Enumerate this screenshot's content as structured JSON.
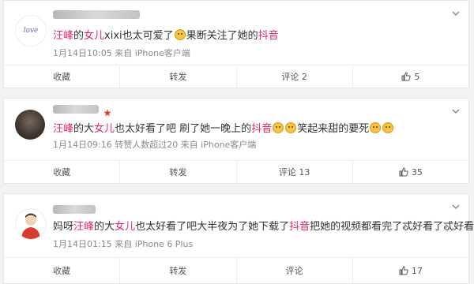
{
  "comments": [
    {
      "avatar_text": "love",
      "text_before": "",
      "highlight1": "汪峰",
      "text_mid1": "的",
      "highlight2": "女儿",
      "text_mid2": "xixi也太可爱了",
      "text_mid3": "果断关注了她的",
      "highlight3": "抖音",
      "text_after": "",
      "meta": "1月14日10:05 来自 iPhone客户端",
      "actions": {
        "collect": "收藏",
        "repost": "转发",
        "comment": "评论 2",
        "like_count": "5"
      }
    },
    {
      "text_before": "",
      "highlight1": "汪峰",
      "text_mid1": "的大",
      "highlight2": "女儿",
      "text_mid2": "也太好看了吧 刷了她一晚上的",
      "highlight3": "抖音",
      "text_after": "笑起来甜的要死",
      "meta": "1月14日09:16 转赞人数超过20 来自 iPhone客户端",
      "actions": {
        "collect": "收藏",
        "repost": "转发",
        "comment": "评论 13",
        "like_count": "35"
      }
    },
    {
      "text_before": "妈呀",
      "highlight1": "汪峰",
      "text_mid1": "的大",
      "highlight2": "女儿",
      "text_mid2": "也太好看了吧大半夜为了她下载了",
      "highlight3": "抖音",
      "text_after": "把她的视频都看完了忒好看了忒好看了",
      "meta": "1月14日01:15 来自 iPhone 6 Plus",
      "actions": {
        "collect": "收藏",
        "repost": "转发",
        "comment": "评论",
        "like_count": "17"
      }
    }
  ],
  "colors": {
    "highlight": "#e0245e",
    "meta": "#8a8a8a",
    "badge": "#e8402f"
  }
}
